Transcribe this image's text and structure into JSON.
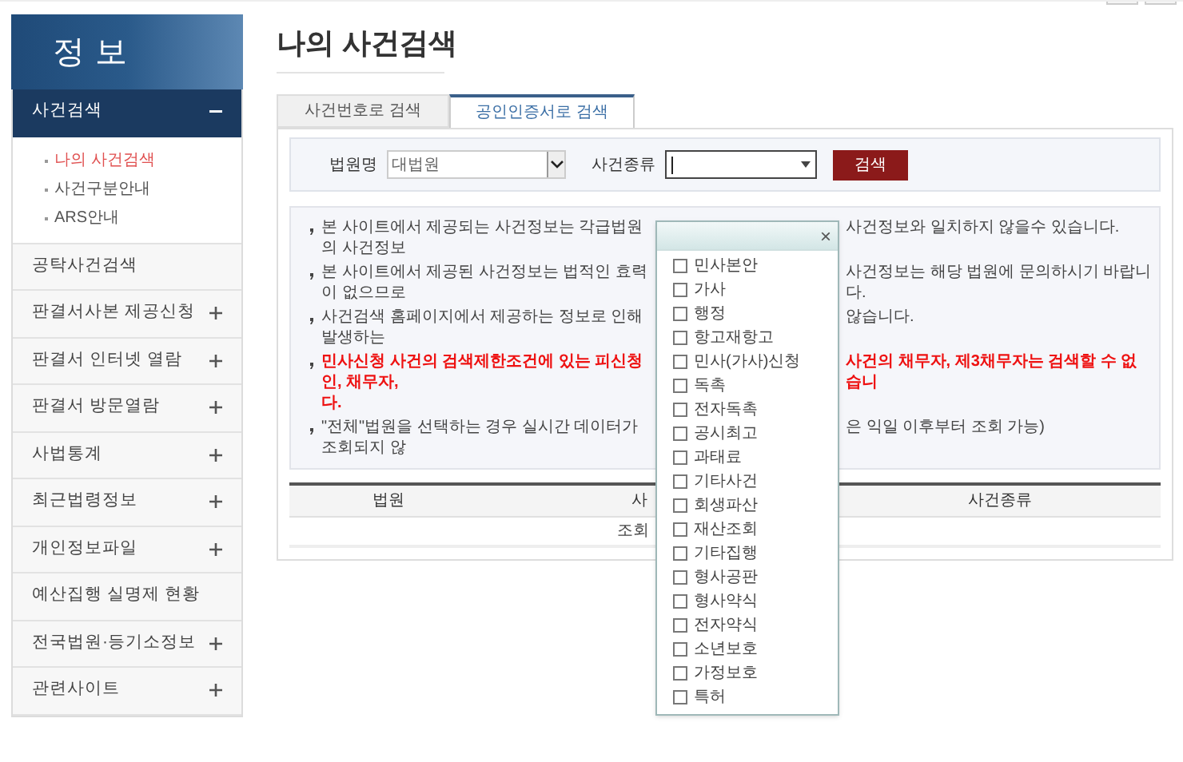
{
  "sidebar": {
    "title": "정 보",
    "items": [
      {
        "label": "사건검색",
        "kind": "group",
        "expanded": true,
        "children": [
          {
            "label": "나의 사건검색",
            "selected": true
          },
          {
            "label": "사건구분안내",
            "selected": false
          },
          {
            "label": "ARS안내",
            "selected": false
          }
        ]
      },
      {
        "label": "공탁사건검색",
        "kind": "link"
      },
      {
        "label": "판결서사본 제공신청",
        "kind": "group",
        "expanded": false
      },
      {
        "label": "판결서 인터넷 열람",
        "kind": "group",
        "expanded": false
      },
      {
        "label": "판결서 방문열람",
        "kind": "group",
        "expanded": false
      },
      {
        "label": "사법통계",
        "kind": "group",
        "expanded": false
      },
      {
        "label": "최근법령정보",
        "kind": "group",
        "expanded": false
      },
      {
        "label": "개인정보파일",
        "kind": "group",
        "expanded": false
      },
      {
        "label": "예산집행 실명제 현황",
        "kind": "link"
      },
      {
        "label": "전국법원·등기소정보",
        "kind": "group",
        "expanded": false
      },
      {
        "label": "관련사이트",
        "kind": "group",
        "expanded": false
      }
    ]
  },
  "page_title": "나의 사건검색",
  "tabs": [
    {
      "label": "사건번호로 검색",
      "selected": false
    },
    {
      "label": "공인인증서로 검색",
      "selected": true
    }
  ],
  "search": {
    "court_label": "법원명",
    "court_value": "대법원",
    "type_label": "사건종류",
    "button": "검색"
  },
  "notices": [
    {
      "left": "본 사이트에서 제공되는 사건정보는 각급법원의 사건정보",
      "right": "사건정보와 일치하지 않을수 있습니다.",
      "red": false
    },
    {
      "left": "본 사이트에서 제공된 사건정보는 법적인 효력이 없으므로",
      "right": "사건정보는 해당 법원에 문의하시기 바랍니다.",
      "red": false
    },
    {
      "left": "사건검색 홈페이지에서 제공하는 정보로 인해 발생하는",
      "right": "않습니다.",
      "red": false
    },
    {
      "left": "민사신청 사건의 검색제한조건에 있는 피신청인, 채무자,",
      "right": "사건의 채무자, 제3채무자는 검색할 수 없습니",
      "cont": "다.",
      "red": true
    },
    {
      "left": "\"전체\"법원을 선택하는 경우 실시간 데이터가 조회되지 않",
      "right": "은 익일 이후부터 조회 가능)",
      "red": false
    }
  ],
  "table": {
    "columns": [
      "법원",
      "사",
      "사건종류"
    ],
    "empty_message": "조회"
  },
  "popup": {
    "close": "×",
    "options": [
      {
        "label": "민사본안",
        "checked": false
      },
      {
        "label": "가사",
        "checked": false
      },
      {
        "label": "행정",
        "checked": false
      },
      {
        "label": "항고재항고",
        "checked": false
      },
      {
        "label": "민사(가사)신청",
        "checked": false
      },
      {
        "label": "독촉",
        "checked": false
      },
      {
        "label": "전자독촉",
        "checked": false
      },
      {
        "label": "공시최고",
        "checked": false
      },
      {
        "label": "과태료",
        "checked": false
      },
      {
        "label": "기타사건",
        "checked": false
      },
      {
        "label": "회생파산",
        "checked": false
      },
      {
        "label": "재산조회",
        "checked": false
      },
      {
        "label": "기타집행",
        "checked": false
      },
      {
        "label": "형사공판",
        "checked": false
      },
      {
        "label": "형사약식",
        "checked": false
      },
      {
        "label": "전자약식",
        "checked": false
      },
      {
        "label": "소년보호",
        "checked": false
      },
      {
        "label": "가정보호",
        "checked": false
      },
      {
        "label": "특허",
        "checked": false
      }
    ]
  }
}
